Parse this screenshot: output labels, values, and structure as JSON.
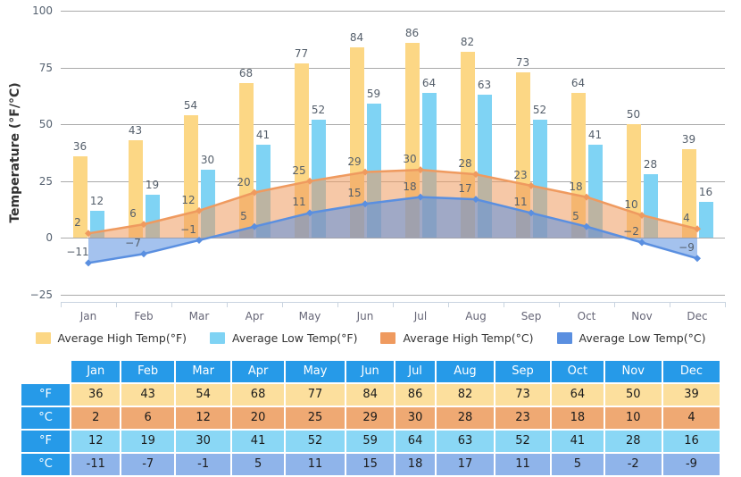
{
  "chart_data": {
    "type": "bar",
    "title": "",
    "xlabel": "",
    "ylabel": "Temperature (°F/°C)",
    "ylim": [
      -25,
      100
    ],
    "yticks": [
      100,
      75,
      50,
      25,
      0,
      -25
    ],
    "grid": true,
    "legend_position": "bottom",
    "categories": [
      "Jan",
      "Feb",
      "Mar",
      "Apr",
      "May",
      "Jun",
      "Jul",
      "Aug",
      "Sep",
      "Oct",
      "Nov",
      "Dec"
    ],
    "series": [
      {
        "name": "Average High Temp(°F)",
        "type": "bar",
        "color": "#fcd785",
        "values": [
          36,
          43,
          54,
          68,
          77,
          84,
          86,
          82,
          73,
          64,
          50,
          39
        ]
      },
      {
        "name": "Average Low Temp(°F)",
        "type": "bar",
        "color": "#7fd3f4",
        "values": [
          12,
          19,
          30,
          41,
          52,
          59,
          64,
          63,
          52,
          41,
          28,
          16
        ]
      },
      {
        "name": "Average High Temp(°C)",
        "type": "area",
        "color": "#ef9a5f",
        "values": [
          2,
          6,
          12,
          20,
          25,
          29,
          30,
          28,
          23,
          18,
          10,
          4
        ]
      },
      {
        "name": "Average Low Temp(°C)",
        "type": "area",
        "color": "#5a8fe0",
        "values": [
          -11,
          -7,
          -1,
          5,
          11,
          15,
          18,
          17,
          11,
          5,
          -2,
          -9
        ]
      }
    ]
  },
  "table": {
    "corner_label": "",
    "month_headers": [
      "Jan",
      "Feb",
      "Mar",
      "Apr",
      "May",
      "Jun",
      "Jul",
      "Aug",
      "Sep",
      "Oct",
      "Nov",
      "Dec"
    ],
    "rows": [
      {
        "unit": "°F",
        "cell_class": "c-highf",
        "values": [
          "36",
          "43",
          "54",
          "68",
          "77",
          "84",
          "86",
          "82",
          "73",
          "64",
          "50",
          "39"
        ]
      },
      {
        "unit": "°C",
        "cell_class": "c-highc",
        "values": [
          "2",
          "6",
          "12",
          "20",
          "25",
          "29",
          "30",
          "28",
          "23",
          "18",
          "10",
          "4"
        ]
      },
      {
        "unit": "°F",
        "cell_class": "c-lowf",
        "values": [
          "12",
          "19",
          "30",
          "41",
          "52",
          "59",
          "64",
          "63",
          "52",
          "41",
          "28",
          "16"
        ]
      },
      {
        "unit": "°C",
        "cell_class": "c-lowc",
        "values": [
          "-11",
          "-7",
          "-1",
          "5",
          "11",
          "15",
          "18",
          "17",
          "11",
          "5",
          "-2",
          "-9"
        ]
      }
    ]
  },
  "colors": {
    "high_f": "#fcd785",
    "low_f": "#7fd3f4",
    "high_c": "#ef9a5f",
    "low_c": "#5a8fe0",
    "table_header": "#269ae8",
    "gridline": "#aaaaaa",
    "axis": "#c9d4e0"
  }
}
